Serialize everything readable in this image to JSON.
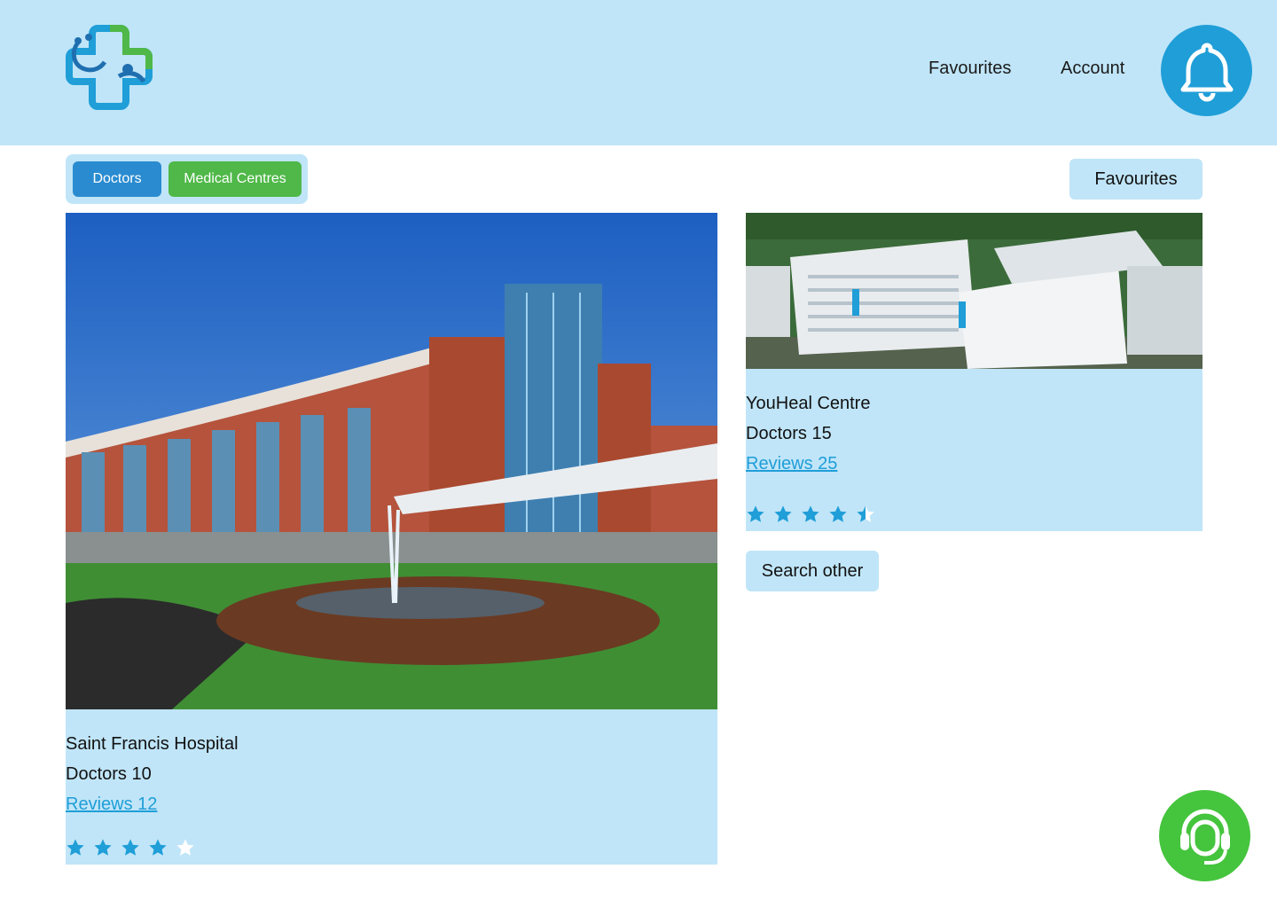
{
  "header": {
    "logo_icon": "medical-cross-stethoscope-logo",
    "nav": {
      "favourites_label": "Favourites",
      "account_label": "Account"
    },
    "notification_icon": "bell-icon"
  },
  "filters": {
    "tabs": [
      {
        "label": "Doctors",
        "color": "#2a8bd0"
      },
      {
        "label": "Medical Centres",
        "color": "#4fb848"
      }
    ]
  },
  "favourites_button_label": "Favourites",
  "centres": [
    {
      "name": "Saint Francis Hospital",
      "doctors": "Doctors 10",
      "reviews": "Reviews 12",
      "rating": 4,
      "rating_max": 5,
      "image": "hospital-building-photo"
    },
    {
      "name": "YouHeal Centre",
      "doctors": "Doctors 15",
      "reviews": "Reviews 25",
      "rating": 4.5,
      "rating_max": 5,
      "image": "hospital-aerial-photo"
    }
  ],
  "search_other_label": "Search other",
  "support_icon": "headset-support-icon",
  "colors": {
    "accent_blue": "#1f9ed8",
    "light_blue": "#c0e5f8",
    "green": "#45c43d"
  }
}
